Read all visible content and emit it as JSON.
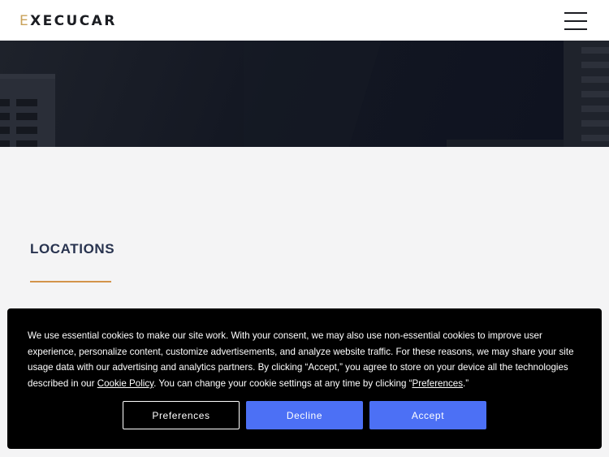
{
  "header": {
    "logo_e": "E",
    "logo_rest": "XECUCAR",
    "menu_icon": "hamburger-menu-icon"
  },
  "locations": {
    "title": "LOCATIONS"
  },
  "cookie_banner": {
    "text_before_policy": "We use essential cookies to make our site work. With your consent, we may also use non-essential cookies to improve user experience, personalize content, customize advertisements, and analyze website traffic. For these reasons, we may share your site usage data with our advertising and analytics partners. By clicking “Accept,” you agree to store on your device all the technologies described in our ",
    "policy_link": "Cookie Policy",
    "text_middle": ". You can change your cookie settings at any time by clicking “",
    "preferences_link": "Preferences",
    "text_end": ".”",
    "preferences_label": "Preferences",
    "decline_label": "Decline",
    "accept_label": "Accept"
  },
  "colors": {
    "accent_gold": "#d3944a",
    "button_blue": "#4c70f5",
    "title_navy": "#28334f"
  }
}
